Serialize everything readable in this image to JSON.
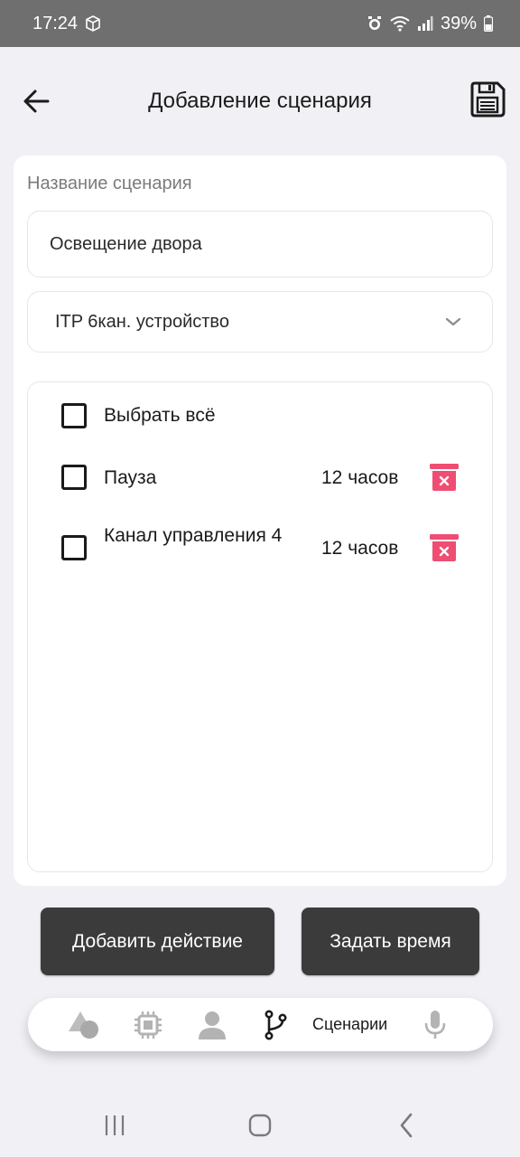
{
  "status": {
    "time": "17:24",
    "battery": "39%"
  },
  "header": {
    "title": "Добавление сценария",
    "back_icon": "arrow-left-icon",
    "save_icon": "floppy-disk-icon"
  },
  "form": {
    "name_label": "Название сценария",
    "name_value": "Освещение двора",
    "device_selected": "ITP 6кан. устройство"
  },
  "actions": {
    "select_all_label": "Выбрать всё",
    "items": [
      {
        "label": "Пауза",
        "duration": "12 часов"
      },
      {
        "label": "Канал управления 4",
        "duration": "12 часов"
      }
    ]
  },
  "buttons": {
    "add_action": "Добавить действие",
    "set_time": "Задать время"
  },
  "tabbar": {
    "active_label": "Сценарии",
    "tabs": [
      "shapes-icon",
      "chip-icon",
      "user-icon",
      "branch-icon",
      "microphone-icon"
    ]
  },
  "colors": {
    "accent_delete": "#ef4d72",
    "button_bg": "#3b3b3b",
    "background": "#f1f0f5"
  }
}
